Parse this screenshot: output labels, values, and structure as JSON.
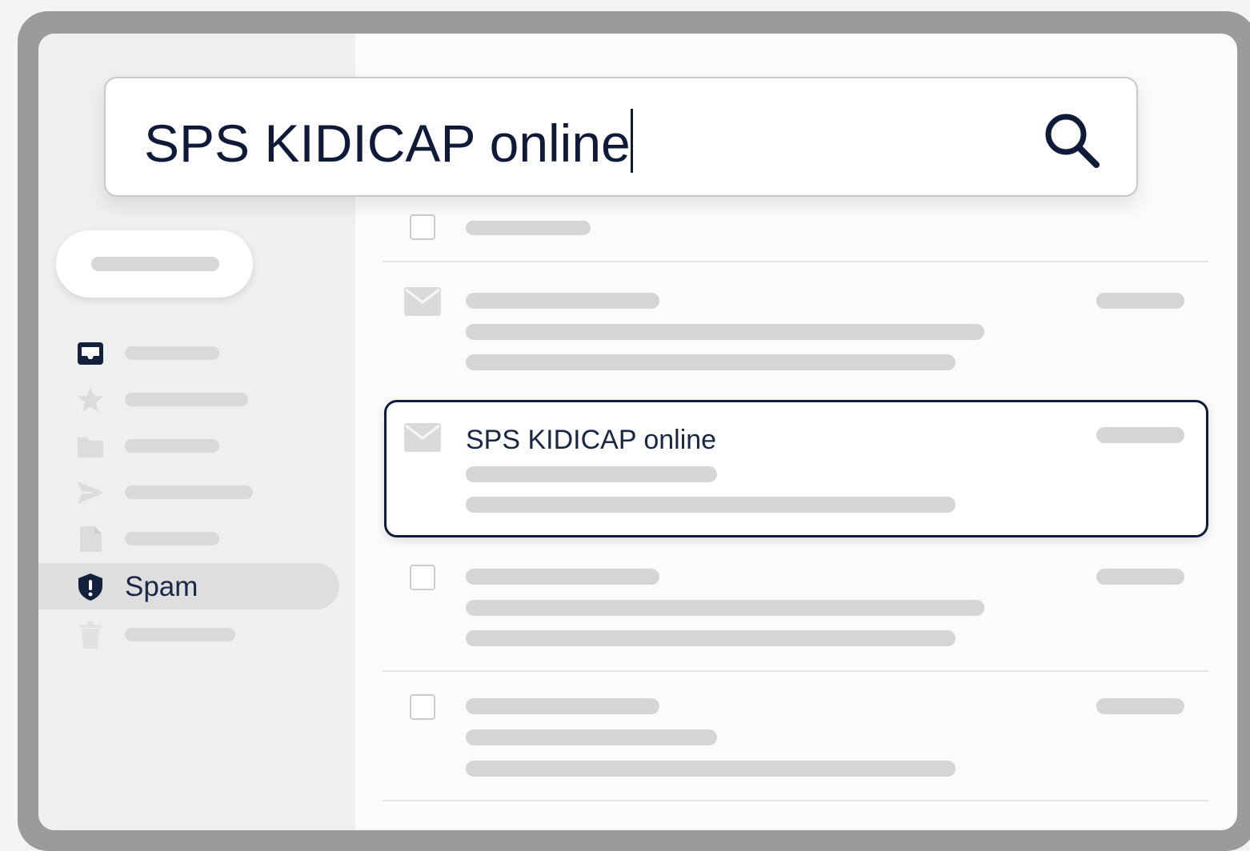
{
  "search": {
    "query": "SPS KIDICAP online"
  },
  "sidebar": {
    "items": [
      {
        "icon": "inbox-icon",
        "label": ""
      },
      {
        "icon": "star-icon",
        "label": ""
      },
      {
        "icon": "folder-icon",
        "label": ""
      },
      {
        "icon": "send-icon",
        "label": ""
      },
      {
        "icon": "draft-icon",
        "label": ""
      },
      {
        "icon": "shield-alert-icon",
        "label": "Spam",
        "active": true
      },
      {
        "icon": "trash-icon",
        "label": ""
      }
    ]
  },
  "messages": [
    {
      "icon": "checkbox",
      "subject": ""
    },
    {
      "icon": "envelope-icon",
      "subject": ""
    },
    {
      "icon": "envelope-icon",
      "subject": "SPS KIDICAP online",
      "highlighted": true
    },
    {
      "icon": "checkbox",
      "subject": ""
    },
    {
      "icon": "checkbox",
      "subject": ""
    }
  ],
  "colors": {
    "accent": "#0f1b3a",
    "sidebar_bg": "#efefef",
    "placeholder_bar": "#d5d5d5"
  }
}
